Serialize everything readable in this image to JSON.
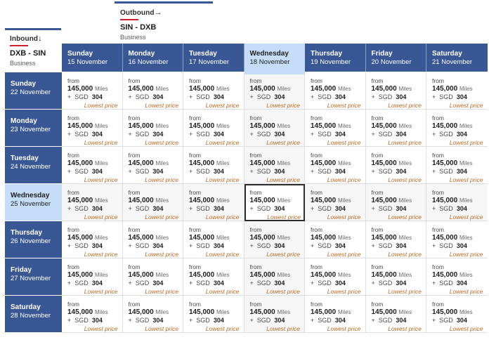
{
  "colors": {
    "header_blue": "#3a5795",
    "selected_blue": "#c5ddf7",
    "accent_red": "#d0202f",
    "lowest_price_orange": "#bb6a24",
    "cell_tint": "#f6f6f6",
    "selected_cell_border": "#2c2c2c"
  },
  "outbound": {
    "direction_label": "Outbound",
    "direction_icon": "arrow-right",
    "arrow_glyph": "→",
    "route": "SIN - DXB",
    "cabin": "Business"
  },
  "inbound": {
    "direction_label": "Inbound",
    "direction_icon": "arrow-down",
    "arrow_glyph": "↓",
    "route": "DXB - SIN",
    "cabin": "Business"
  },
  "columns": [
    {
      "day": "Sunday",
      "date": "15 November",
      "selected": false
    },
    {
      "day": "Monday",
      "date": "16 November",
      "selected": false
    },
    {
      "day": "Tuesday",
      "date": "17 November",
      "selected": false
    },
    {
      "day": "Wednesday",
      "date": "18 November",
      "selected": true
    },
    {
      "day": "Thursday",
      "date": "19 November",
      "selected": false
    },
    {
      "day": "Friday",
      "date": "20 November",
      "selected": false
    },
    {
      "day": "Saturday",
      "date": "21 November",
      "selected": false
    }
  ],
  "rows": [
    {
      "day": "Sunday",
      "date": "22 November",
      "selected": false
    },
    {
      "day": "Monday",
      "date": "23 November",
      "selected": false
    },
    {
      "day": "Tuesday",
      "date": "24 November",
      "selected": false
    },
    {
      "day": "Wednesday",
      "date": "25 November",
      "selected": true
    },
    {
      "day": "Thursday",
      "date": "26 November",
      "selected": false
    },
    {
      "day": "Friday",
      "date": "27 November",
      "selected": false
    },
    {
      "day": "Saturday",
      "date": "28 November",
      "selected": false
    }
  ],
  "cell_template": {
    "from_label": "from",
    "miles_amount": "145,000",
    "miles_unit": "Miles",
    "cash_prefix": "+",
    "currency": "SGD",
    "cash_amount": "304",
    "lowest_price_label": "Lowest price"
  },
  "selected_cell": {
    "row": 3,
    "column": 3
  },
  "fare_matrix": [
    [
      {
        "from": "from",
        "miles": "145,000",
        "unit": "Miles",
        "prefix": "+",
        "currency": "SGD",
        "cash": "304",
        "tag": "Lowest price"
      },
      {
        "from": "from",
        "miles": "145,000",
        "unit": "Miles",
        "prefix": "+",
        "currency": "SGD",
        "cash": "304",
        "tag": "Lowest price"
      },
      {
        "from": "from",
        "miles": "145,000",
        "unit": "Miles",
        "prefix": "+",
        "currency": "SGD",
        "cash": "304",
        "tag": "Lowest price"
      },
      {
        "from": "from",
        "miles": "145,000",
        "unit": "Miles",
        "prefix": "+",
        "currency": "SGD",
        "cash": "304",
        "tag": "Lowest price"
      },
      {
        "from": "from",
        "miles": "145,000",
        "unit": "Miles",
        "prefix": "+",
        "currency": "SGD",
        "cash": "304",
        "tag": "Lowest price"
      },
      {
        "from": "from",
        "miles": "145,000",
        "unit": "Miles",
        "prefix": "+",
        "currency": "SGD",
        "cash": "304",
        "tag": "Lowest price"
      },
      {
        "from": "from",
        "miles": "145,000",
        "unit": "Miles",
        "prefix": "+",
        "currency": "SGD",
        "cash": "304",
        "tag": "Lowest price"
      }
    ],
    [
      {
        "from": "from",
        "miles": "145,000",
        "unit": "Miles",
        "prefix": "+",
        "currency": "SGD",
        "cash": "304",
        "tag": "Lowest price"
      },
      {
        "from": "from",
        "miles": "145,000",
        "unit": "Miles",
        "prefix": "+",
        "currency": "SGD",
        "cash": "304",
        "tag": "Lowest price"
      },
      {
        "from": "from",
        "miles": "145,000",
        "unit": "Miles",
        "prefix": "+",
        "currency": "SGD",
        "cash": "304",
        "tag": "Lowest price"
      },
      {
        "from": "from",
        "miles": "145,000",
        "unit": "Miles",
        "prefix": "+",
        "currency": "SGD",
        "cash": "304",
        "tag": "Lowest price"
      },
      {
        "from": "from",
        "miles": "145,000",
        "unit": "Miles",
        "prefix": "+",
        "currency": "SGD",
        "cash": "304",
        "tag": "Lowest price"
      },
      {
        "from": "from",
        "miles": "145,000",
        "unit": "Miles",
        "prefix": "+",
        "currency": "SGD",
        "cash": "304",
        "tag": "Lowest price"
      },
      {
        "from": "from",
        "miles": "145,000",
        "unit": "Miles",
        "prefix": "+",
        "currency": "SGD",
        "cash": "304",
        "tag": "Lowest price"
      }
    ],
    [
      {
        "from": "from",
        "miles": "145,000",
        "unit": "Miles",
        "prefix": "+",
        "currency": "SGD",
        "cash": "304",
        "tag": "Lowest price"
      },
      {
        "from": "from",
        "miles": "145,000",
        "unit": "Miles",
        "prefix": "+",
        "currency": "SGD",
        "cash": "304",
        "tag": "Lowest price"
      },
      {
        "from": "from",
        "miles": "145,000",
        "unit": "Miles",
        "prefix": "+",
        "currency": "SGD",
        "cash": "304",
        "tag": "Lowest price"
      },
      {
        "from": "from",
        "miles": "145,000",
        "unit": "Miles",
        "prefix": "+",
        "currency": "SGD",
        "cash": "304",
        "tag": "Lowest price"
      },
      {
        "from": "from",
        "miles": "145,000",
        "unit": "Miles",
        "prefix": "+",
        "currency": "SGD",
        "cash": "304",
        "tag": "Lowest price"
      },
      {
        "from": "from",
        "miles": "145,000",
        "unit": "Miles",
        "prefix": "+",
        "currency": "SGD",
        "cash": "304",
        "tag": "Lowest price"
      },
      {
        "from": "from",
        "miles": "145,000",
        "unit": "Miles",
        "prefix": "+",
        "currency": "SGD",
        "cash": "304",
        "tag": "Lowest price"
      }
    ],
    [
      {
        "from": "from",
        "miles": "145,000",
        "unit": "Miles",
        "prefix": "+",
        "currency": "SGD",
        "cash": "304",
        "tag": "Lowest price"
      },
      {
        "from": "from",
        "miles": "145,000",
        "unit": "Miles",
        "prefix": "+",
        "currency": "SGD",
        "cash": "304",
        "tag": "Lowest price"
      },
      {
        "from": "from",
        "miles": "145,000",
        "unit": "Miles",
        "prefix": "+",
        "currency": "SGD",
        "cash": "304",
        "tag": "Lowest price"
      },
      {
        "from": "from",
        "miles": "145,000",
        "unit": "Miles",
        "prefix": "+",
        "currency": "SGD",
        "cash": "304",
        "tag": "Lowest price"
      },
      {
        "from": "from",
        "miles": "145,000",
        "unit": "Miles",
        "prefix": "+",
        "currency": "SGD",
        "cash": "304",
        "tag": "Lowest price"
      },
      {
        "from": "from",
        "miles": "145,000",
        "unit": "Miles",
        "prefix": "+",
        "currency": "SGD",
        "cash": "304",
        "tag": "Lowest price"
      },
      {
        "from": "from",
        "miles": "145,000",
        "unit": "Miles",
        "prefix": "+",
        "currency": "SGD",
        "cash": "304",
        "tag": "Lowest price"
      }
    ],
    [
      {
        "from": "from",
        "miles": "145,000",
        "unit": "Miles",
        "prefix": "+",
        "currency": "SGD",
        "cash": "304",
        "tag": "Lowest price"
      },
      {
        "from": "from",
        "miles": "145,000",
        "unit": "Miles",
        "prefix": "+",
        "currency": "SGD",
        "cash": "304",
        "tag": "Lowest price"
      },
      {
        "from": "from",
        "miles": "145,000",
        "unit": "Miles",
        "prefix": "+",
        "currency": "SGD",
        "cash": "304",
        "tag": "Lowest price"
      },
      {
        "from": "from",
        "miles": "145,000",
        "unit": "Miles",
        "prefix": "+",
        "currency": "SGD",
        "cash": "304",
        "tag": "Lowest price"
      },
      {
        "from": "from",
        "miles": "145,000",
        "unit": "Miles",
        "prefix": "+",
        "currency": "SGD",
        "cash": "304",
        "tag": "Lowest price"
      },
      {
        "from": "from",
        "miles": "145,000",
        "unit": "Miles",
        "prefix": "+",
        "currency": "SGD",
        "cash": "304",
        "tag": "Lowest price"
      },
      {
        "from": "from",
        "miles": "145,000",
        "unit": "Miles",
        "prefix": "+",
        "currency": "SGD",
        "cash": "304",
        "tag": "Lowest price"
      }
    ],
    [
      {
        "from": "from",
        "miles": "145,000",
        "unit": "Miles",
        "prefix": "+",
        "currency": "SGD",
        "cash": "304",
        "tag": "Lowest price"
      },
      {
        "from": "from",
        "miles": "145,000",
        "unit": "Miles",
        "prefix": "+",
        "currency": "SGD",
        "cash": "304",
        "tag": "Lowest price"
      },
      {
        "from": "from",
        "miles": "145,000",
        "unit": "Miles",
        "prefix": "+",
        "currency": "SGD",
        "cash": "304",
        "tag": "Lowest price"
      },
      {
        "from": "from",
        "miles": "145,000",
        "unit": "Miles",
        "prefix": "+",
        "currency": "SGD",
        "cash": "304",
        "tag": "Lowest price"
      },
      {
        "from": "from",
        "miles": "145,000",
        "unit": "Miles",
        "prefix": "+",
        "currency": "SGD",
        "cash": "304",
        "tag": "Lowest price"
      },
      {
        "from": "from",
        "miles": "145,000",
        "unit": "Miles",
        "prefix": "+",
        "currency": "SGD",
        "cash": "304",
        "tag": "Lowest price"
      },
      {
        "from": "from",
        "miles": "145,000",
        "unit": "Miles",
        "prefix": "+",
        "currency": "SGD",
        "cash": "304",
        "tag": "Lowest price"
      }
    ],
    [
      {
        "from": "from",
        "miles": "145,000",
        "unit": "Miles",
        "prefix": "+",
        "currency": "SGD",
        "cash": "304",
        "tag": "Lowest price"
      },
      {
        "from": "from",
        "miles": "145,000",
        "unit": "Miles",
        "prefix": "+",
        "currency": "SGD",
        "cash": "304",
        "tag": "Lowest price"
      },
      {
        "from": "from",
        "miles": "145,000",
        "unit": "Miles",
        "prefix": "+",
        "currency": "SGD",
        "cash": "304",
        "tag": "Lowest price"
      },
      {
        "from": "from",
        "miles": "145,000",
        "unit": "Miles",
        "prefix": "+",
        "currency": "SGD",
        "cash": "304",
        "tag": "Lowest price"
      },
      {
        "from": "from",
        "miles": "145,000",
        "unit": "Miles",
        "prefix": "+",
        "currency": "SGD",
        "cash": "304",
        "tag": "Lowest price"
      },
      {
        "from": "from",
        "miles": "145,000",
        "unit": "Miles",
        "prefix": "+",
        "currency": "SGD",
        "cash": "304",
        "tag": "Lowest price"
      },
      {
        "from": "from",
        "miles": "145,000",
        "unit": "Miles",
        "prefix": "+",
        "currency": "SGD",
        "cash": "304",
        "tag": "Lowest price"
      }
    ]
  ]
}
